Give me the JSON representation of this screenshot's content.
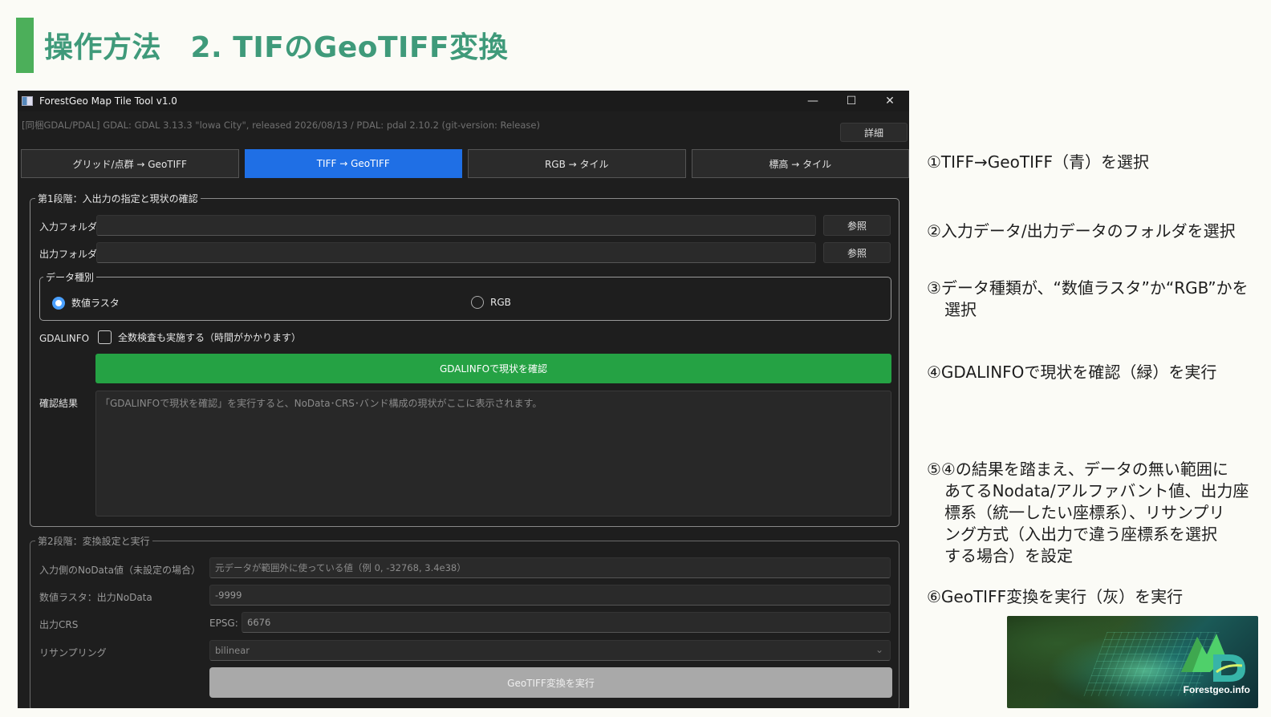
{
  "slide": {
    "title": "操作方法　2. TIFのGeoTIFF変換"
  },
  "window": {
    "title": "ForestGeo Map Tile Tool v1.0",
    "controls": {
      "minimize": "—",
      "maximize": "☐",
      "close": "✕"
    }
  },
  "infobar": {
    "text": "[同梱GDAL/PDAL]  GDAL: GDAL 3.13.3 \"lowa City\", released 2026/08/13  /  PDAL: pdal 2.10.2 (git-version: Release)",
    "detail_button": "詳細"
  },
  "tabs": [
    {
      "label": "グリッド/点群 → GeoTIFF",
      "active": false
    },
    {
      "label": "TIFF → GeoTIFF",
      "active": true
    },
    {
      "label": "RGB → タイル",
      "active": false
    },
    {
      "label": "標高 → タイル",
      "active": false
    }
  ],
  "stage1": {
    "legend": "第1段階：入出力の指定と現状の確認",
    "input_folder_label": "入力フォルダ",
    "input_folder_value": "",
    "output_folder_label": "出力フォルダ",
    "output_folder_value": "",
    "browse_label": "参照",
    "data_type": {
      "legend": "データ種別",
      "options": [
        "数値ラスタ",
        "RGB"
      ],
      "selected": "数値ラスタ"
    },
    "gdalinfo_label": "GDALINFO",
    "full_check_label": "全数検査も実施する（時間がかかります）",
    "full_check_checked": false,
    "check_button": "GDALINFOで現状を確認",
    "result_label": "確認結果",
    "result_placeholder": "「GDALINFOで現状を確認」を実行すると、NoData･CRS･バンド構成の現状がここに表示されます。"
  },
  "stage2": {
    "legend": "第2段階：変換設定と実行",
    "nodata_in_label": "入力側のNoData値（未設定の場合）",
    "nodata_in_placeholder": "元データが範囲外に使っている値（例 0, -32768, 3.4e38）",
    "nodata_out_label": "数値ラスタ：出力NoData",
    "nodata_out_value": "-9999",
    "crs_label": "出力CRS",
    "epsg_label": "EPSG:",
    "epsg_value": "6676",
    "resampling_label": "リサンプリング",
    "resampling_value": "bilinear",
    "run_button": "GeoTIFF変換を実行"
  },
  "notes": [
    {
      "lines": [
        "①TIFF→GeoTIFF（青）を選択"
      ]
    },
    {
      "lines": [
        "②入力データ/出力データのフォルダを選択"
      ]
    },
    {
      "lines": [
        "③データ種類が、“数値ラスタ”か“RGB”かを",
        "選択"
      ]
    },
    {
      "lines": [
        "④GDALINFOで現状を確認（緑）を実行"
      ]
    },
    {
      "lines": [
        "⑤④の結果を踏まえ、データの無い範囲に",
        "あてるNodata/アルファバント値、出力座",
        "標系（統一したい座標系）、リサンプリ",
        "ング方式（入出力で違う座標系を選択",
        "する場合）を設定"
      ]
    },
    {
      "lines": [
        "⑥GeoTIFF変換を実行（灰）を実行"
      ]
    }
  ],
  "logo": {
    "text": "Forestgeo.info",
    "icon": "forestgeo-logo-icon"
  },
  "colors": {
    "accent_green": "#4caf5a",
    "title_teal": "#3f9a7a",
    "tab_active_blue": "#1f6fe5",
    "check_button_green": "#25a244",
    "run_button_gray": "#a9a9a9"
  }
}
